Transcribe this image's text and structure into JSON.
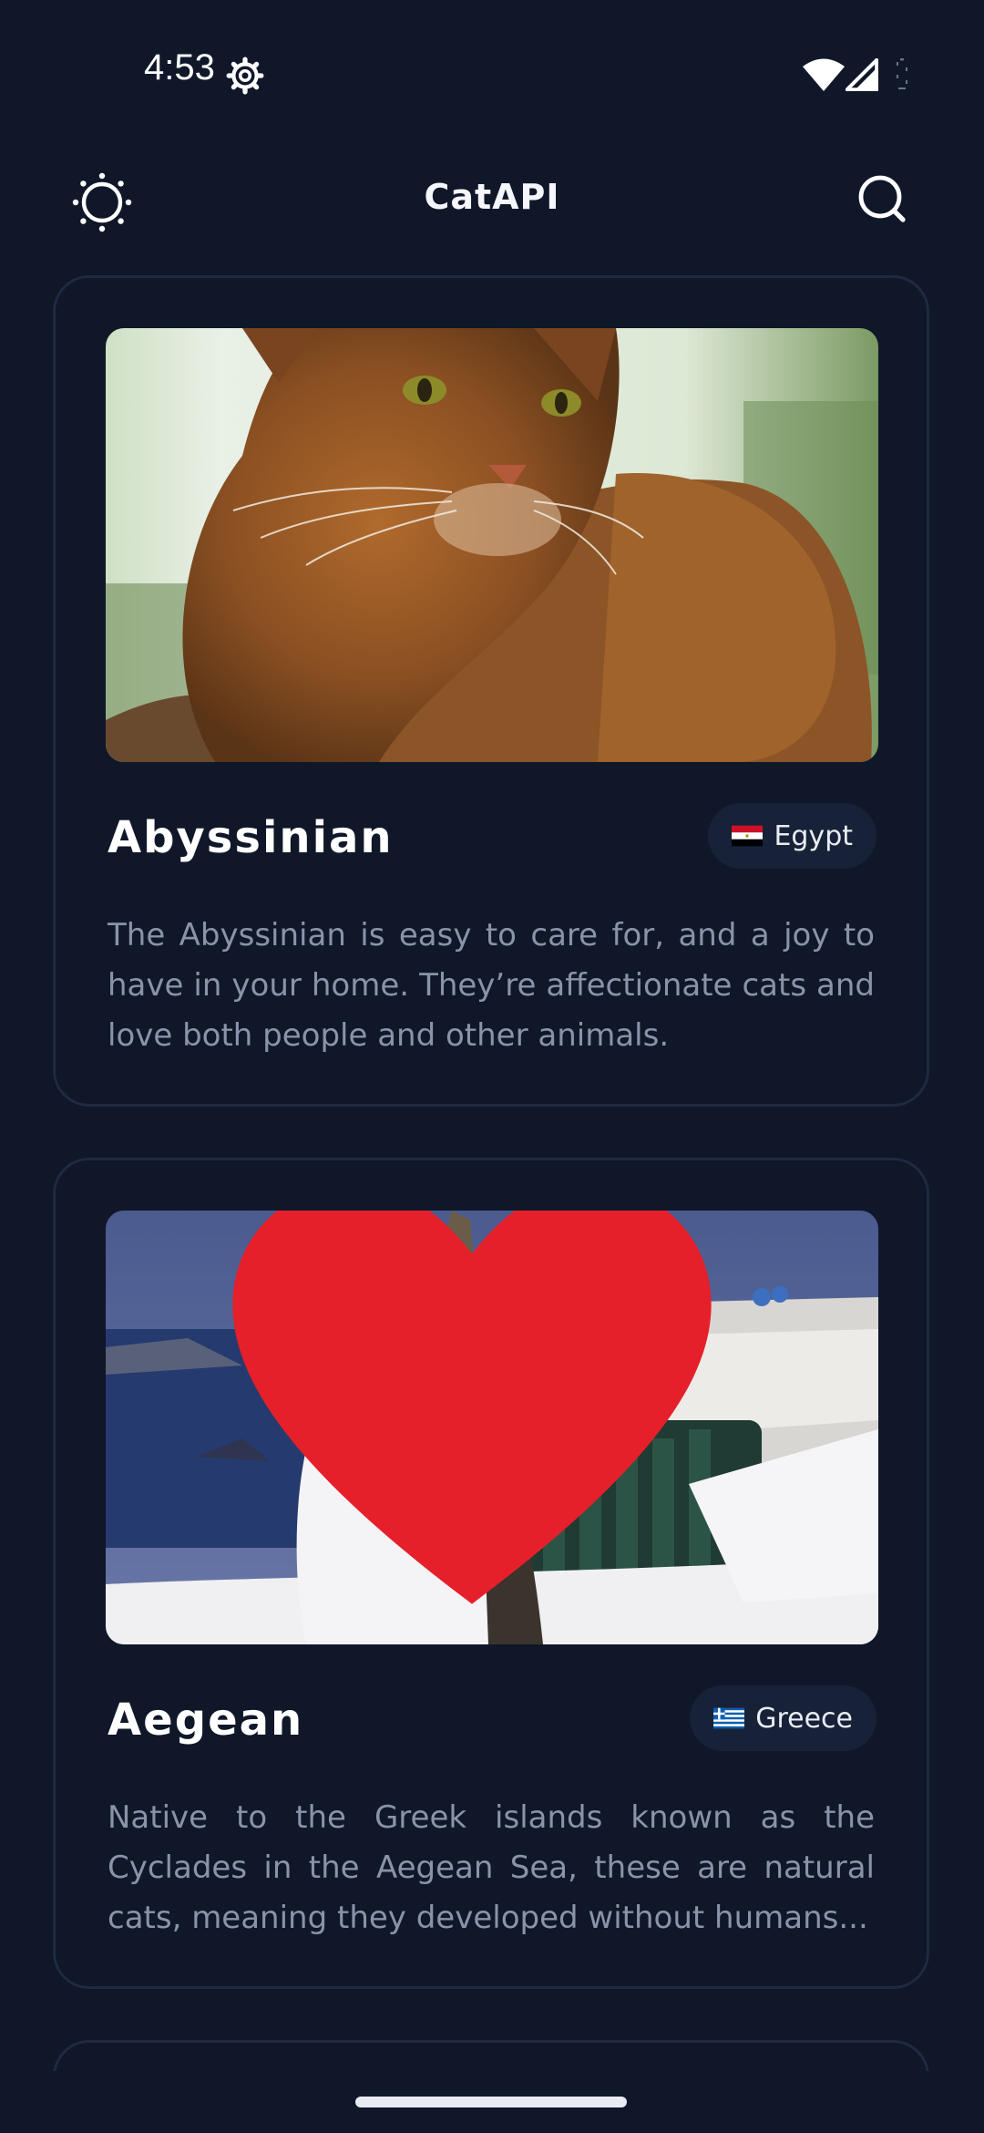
{
  "status_bar": {
    "time": "4:53",
    "icons": [
      "gear-icon",
      "wifi-icon",
      "signal-icon",
      "battery-icon"
    ]
  },
  "app_bar": {
    "title": "CatAPI",
    "left_icon": "sun-icon",
    "right_icon": "search-icon"
  },
  "breeds": [
    {
      "name": "Abyssinian",
      "origin": "Egypt",
      "flag": "egypt-flag-icon",
      "description": "The Abyssinian is easy to care for, and a joy to have in your home. They’re affectionate cats and love both people and other animals.",
      "favorite": false
    },
    {
      "name": "Aegean",
      "origin": "Greece",
      "flag": "greece-flag-icon",
      "description": "Native to the Greek islands known as the Cyclades in the Aegean Sea, these are natural cats, meaning they developed without humans...",
      "favorite": true
    }
  ],
  "colors": {
    "background": "#0f1729",
    "card_border": "#1f2a40",
    "badge_bg": "#172238",
    "description_text": "#8a93a8",
    "favorite_heart": "#e5202a"
  }
}
